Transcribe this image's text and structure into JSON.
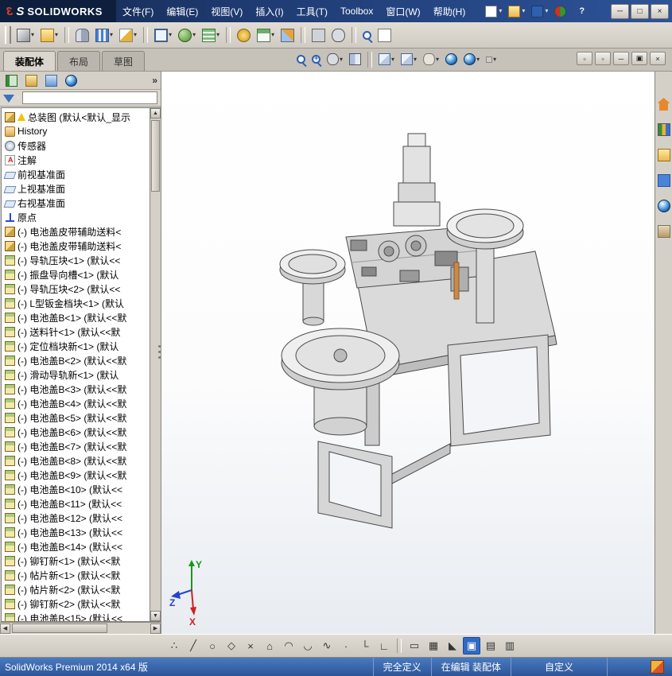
{
  "colors": {
    "titlebar": "#1b3a75",
    "statusbar": "#3565ad",
    "active_tool": "#316ac5",
    "brand_red": "#d8402a",
    "viewport_bg": "#ffffff"
  },
  "titlebar": {
    "mark1": "3",
    "mark2": "S",
    "brand": "SOLIDWORKS",
    "menus": [
      {
        "name": "menu-file",
        "label": "文件(F)"
      },
      {
        "name": "menu-edit",
        "label": "编辑(E)"
      },
      {
        "name": "menu-view",
        "label": "视图(V)"
      },
      {
        "name": "menu-insert",
        "label": "插入(I)"
      },
      {
        "name": "menu-tools",
        "label": "工具(T)"
      },
      {
        "name": "menu-toolbox",
        "label": "Toolbox"
      },
      {
        "name": "menu-window",
        "label": "窗口(W)"
      },
      {
        "name": "menu-help",
        "label": "帮助(H)"
      }
    ],
    "icons": [
      {
        "name": "new-document-icon",
        "icon": "page",
        "caret": true
      },
      {
        "name": "open-icon",
        "icon": "folder",
        "caret": true
      },
      {
        "name": "save-icon",
        "icon": "disk",
        "caret": true
      },
      {
        "name": "rx-icon",
        "icon": "rx"
      },
      {
        "name": "help-icon",
        "icon": "none",
        "glyph": "?"
      }
    ],
    "window_controls": [
      {
        "name": "minimize-button",
        "glyph": "─"
      },
      {
        "name": "maximize-button",
        "glyph": "□"
      },
      {
        "name": "close-button",
        "glyph": "×"
      }
    ]
  },
  "toolbar": {
    "icons": [
      {
        "name": "insert-component-icon",
        "icon": "cube",
        "caret": true
      },
      {
        "name": "insert-from-file-icon",
        "icon": "folder",
        "caret": true
      },
      {
        "sep": true
      },
      {
        "name": "mate-icon",
        "icon": "clip"
      },
      {
        "name": "linear-pattern-icon",
        "icon": "pattern",
        "caret": true
      },
      {
        "name": "smart-fasteners-icon",
        "icon": "wand",
        "caret": true
      },
      {
        "sep": true
      },
      {
        "name": "interference-check-icon",
        "icon": "check",
        "caret": true
      },
      {
        "name": "assembly-features-icon",
        "icon": "gears",
        "caret": true
      },
      {
        "name": "reference-geometry-icon",
        "icon": "grid",
        "caret": true
      },
      {
        "sep": true
      },
      {
        "name": "motion-study-icon",
        "icon": "gear-gold"
      },
      {
        "name": "bill-of-materials-icon",
        "icon": "table",
        "caret": true
      },
      {
        "name": "exploded-view-icon",
        "icon": "explode"
      },
      {
        "sep": true
      },
      {
        "name": "move-component-icon",
        "icon": "move"
      },
      {
        "name": "show-hidden-components-icon",
        "icon": "glasses"
      },
      {
        "sep": true
      },
      {
        "name": "large-design-review-icon",
        "icon": "magnify"
      },
      {
        "name": "update-references-icon",
        "icon": "page"
      }
    ]
  },
  "tabs": [
    {
      "name": "tab-assembly",
      "label": "装配体",
      "active": true
    },
    {
      "name": "tab-layout",
      "label": "布局"
    },
    {
      "name": "tab-sketch",
      "label": "草图"
    }
  ],
  "viewport_toolbar": [
    {
      "name": "zoom-fit-icon",
      "icon": "magnify"
    },
    {
      "name": "zoom-area-icon",
      "icon": "magnify2"
    },
    {
      "name": "previous-view-icon",
      "icon": "glasses",
      "caret": true
    },
    {
      "name": "section-view-icon",
      "icon": "book"
    },
    {
      "sep": true
    },
    {
      "name": "view-orientation-icon",
      "icon": "cubeview",
      "caret": true
    },
    {
      "name": "display-style-icon",
      "icon": "cubeview",
      "caret": true
    },
    {
      "name": "hide-show-items-icon",
      "icon": "eye",
      "caret": true
    },
    {
      "name": "edit-appearance-icon",
      "icon": "globe"
    },
    {
      "name": "apply-scene-icon",
      "icon": "globe",
      "caret": true
    },
    {
      "name": "view-settings-icon",
      "icon": "small",
      "caret": true
    }
  ],
  "doc_controls": [
    {
      "name": "pane-left-button",
      "glyph": "▫"
    },
    {
      "name": "pane-right-button",
      "glyph": "▫"
    },
    {
      "name": "doc-minimize-button",
      "glyph": "─"
    },
    {
      "name": "doc-restore-button",
      "glyph": "▣"
    },
    {
      "name": "doc-close-button",
      "glyph": "×"
    }
  ],
  "panel": {
    "header_icons": [
      {
        "name": "featuremanager-tab-icon",
        "icon": "tree"
      },
      {
        "name": "propertymanager-tab-icon",
        "icon": "prop"
      },
      {
        "name": "configurationmanager-tab-icon",
        "icon": "config"
      },
      {
        "name": "displaymanager-tab-icon",
        "icon": "globe"
      }
    ],
    "overflow": "»",
    "root": {
      "label": "总装图 (默认<默认_显示"
    },
    "items": [
      {
        "icon": "hist",
        "label": "History"
      },
      {
        "icon": "sensor",
        "label": "传感器"
      },
      {
        "icon": "ann",
        "label": "注解"
      },
      {
        "icon": "plane",
        "label": "前视基准面"
      },
      {
        "icon": "plane",
        "label": "上视基准面"
      },
      {
        "icon": "plane",
        "label": "右视基准面"
      },
      {
        "icon": "origin",
        "label": "原点"
      },
      {
        "icon": "asm",
        "label": "(-) 电池盖皮带辅助送料<"
      },
      {
        "icon": "asm",
        "label": "(-) 电池盖皮带辅助送料<"
      },
      {
        "icon": "part",
        "label": "(-) 导轨压块<1> (默认<<"
      },
      {
        "icon": "part",
        "label": "(-) 振盘导向槽<1> (默认"
      },
      {
        "icon": "part",
        "label": "(-) 导轨压块<2> (默认<<"
      },
      {
        "icon": "part",
        "label": "(-) L型钣金档块<1> (默认"
      },
      {
        "icon": "part",
        "label": "(-) 电池盖B<1> (默认<<默"
      },
      {
        "icon": "part",
        "label": "(-) 送料针<1> (默认<<默"
      },
      {
        "icon": "part",
        "label": "(-) 定位档块新<1> (默认"
      },
      {
        "icon": "part",
        "label": "(-) 电池盖B<2> (默认<<默"
      },
      {
        "icon": "part",
        "label": "(-) 滑动导轨新<1> (默认"
      },
      {
        "icon": "part",
        "label": "(-) 电池盖B<3> (默认<<默"
      },
      {
        "icon": "part",
        "label": "(-) 电池盖B<4> (默认<<默"
      },
      {
        "icon": "part",
        "label": "(-) 电池盖B<5> (默认<<默"
      },
      {
        "icon": "part",
        "label": "(-) 电池盖B<6> (默认<<默"
      },
      {
        "icon": "part",
        "label": "(-) 电池盖B<7> (默认<<默"
      },
      {
        "icon": "part",
        "label": "(-) 电池盖B<8> (默认<<默"
      },
      {
        "icon": "part",
        "label": "(-) 电池盖B<9> (默认<<默"
      },
      {
        "icon": "part",
        "label": "(-) 电池盖B<10> (默认<<"
      },
      {
        "icon": "part",
        "label": "(-) 电池盖B<11> (默认<<"
      },
      {
        "icon": "part",
        "label": "(-) 电池盖B<12> (默认<<"
      },
      {
        "icon": "part",
        "label": "(-) 电池盖B<13> (默认<<"
      },
      {
        "icon": "part",
        "label": "(-) 电池盖B<14> (默认<<"
      },
      {
        "icon": "part",
        "label": "(-) 铆钉新<1> (默认<<默"
      },
      {
        "icon": "part",
        "label": "(-) 帖片新<1> (默认<<默"
      },
      {
        "icon": "part",
        "label": "(-) 帖片新<2> (默认<<默"
      },
      {
        "icon": "part",
        "label": "(-) 铆钉新<2> (默认<<默"
      },
      {
        "icon": "part",
        "label": "(-) 电池盖B<15> (默认<<"
      }
    ]
  },
  "taskpane": [
    {
      "name": "home-icon",
      "icon": "home"
    },
    {
      "name": "design-library-icon",
      "icon": "library"
    },
    {
      "name": "file-explorer-icon",
      "icon": "folder"
    },
    {
      "name": "view-palette-icon",
      "icon": "palette"
    },
    {
      "name": "appearances-icon",
      "icon": "globe"
    },
    {
      "name": "custom-properties-icon",
      "icon": "props2"
    }
  ],
  "sketchbar": [
    {
      "name": "select-dots-icon",
      "glyph": "∴"
    },
    {
      "name": "line-icon",
      "glyph": "╱"
    },
    {
      "name": "circle-icon",
      "glyph": "○"
    },
    {
      "name": "ellipse-icon",
      "glyph": "◇"
    },
    {
      "name": "trim-icon",
      "glyph": "×"
    },
    {
      "name": "polygon-icon",
      "glyph": "⌂"
    },
    {
      "name": "arc-icon",
      "glyph": "◠"
    },
    {
      "name": "tangent-arc-icon",
      "glyph": "◡"
    },
    {
      "name": "spline-icon",
      "glyph": "∿"
    },
    {
      "name": "point-icon",
      "glyph": "∙"
    },
    {
      "name": "fillet-icon",
      "glyph": "└"
    },
    {
      "name": "dimension-icon",
      "glyph": "∟"
    },
    {
      "sep": true
    },
    {
      "name": "convert-entities-icon",
      "glyph": "▭"
    },
    {
      "name": "hatch-icon",
      "glyph": "▦"
    },
    {
      "name": "mirror-icon",
      "glyph": "◣"
    },
    {
      "name": "shaded-sketch-icon",
      "glyph": "▣",
      "active": true
    },
    {
      "name": "grid-icon",
      "glyph": "▤"
    },
    {
      "name": "table-icon",
      "glyph": "▥"
    }
  ],
  "statusbar": {
    "left": "SolidWorks Premium 2014 x64 版",
    "defined": "完全定义",
    "editing": "在编辑 装配体",
    "custom": "自定义"
  },
  "viewport": {
    "triad": {
      "x": "X",
      "y": "Y",
      "z": "Z"
    }
  }
}
